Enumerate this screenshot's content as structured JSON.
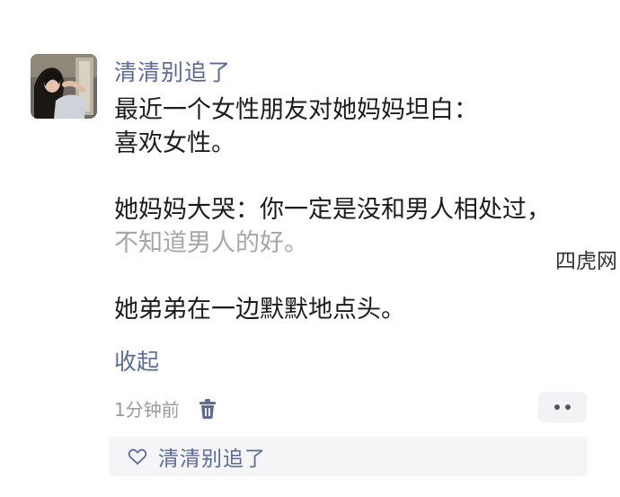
{
  "post": {
    "author": "清清别追了",
    "text_lines": [
      "最近一个女性朋友对她妈妈坦白：",
      "喜欢女性。",
      "",
      "她妈妈大哭：你一定是没和男人相处过，",
      "不知道男人的好。",
      "",
      "她弟弟在一边默默地点头。"
    ],
    "collapse_label": "收起",
    "time": "1分钟前",
    "liked_by": "清清别追了"
  },
  "watermark": "四虎网",
  "icons": {
    "avatar": "user-avatar-photo",
    "delete": "trash-icon",
    "more": "more-dots-icon",
    "like": "heart-outline-icon"
  },
  "colors": {
    "link": "#5a6a99",
    "text": "#1c1c1c",
    "meta": "#9a9a9a",
    "likes_bg": "#f5f5f7"
  }
}
